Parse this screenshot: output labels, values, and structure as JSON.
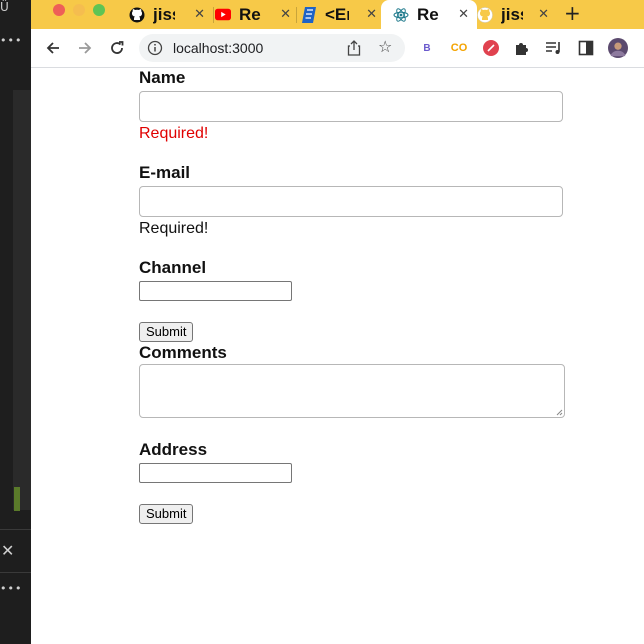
{
  "browser": {
    "tabs": [
      {
        "label": "jissl",
        "icon": "github-icon"
      },
      {
        "label": "Rea",
        "icon": "youtube-icon"
      },
      {
        "label": "<Err",
        "icon": "docs-icon"
      },
      {
        "label": "Rea",
        "icon": "react-icon",
        "active": true
      },
      {
        "label": "jissl",
        "icon": "github-icon"
      }
    ],
    "close_glyph": "✕",
    "new_tab_glyph": "+",
    "url": "localhost:3000",
    "extensions": [
      {
        "text": "B",
        "color": "#6a5acd"
      },
      {
        "text": "CO",
        "color": "#f4a300"
      }
    ],
    "titlebar_color": "#f7c948"
  },
  "form": {
    "name_label": "Name",
    "name_error": "Required!",
    "email_label": "E-mail",
    "email_error": "Required!",
    "channel_label": "Channel",
    "submit_1": "Submit",
    "comments_label": "Comments",
    "address_label": "Address",
    "submit_2": "Submit",
    "error_color": "#e00000",
    "plain_error_color": "#111111"
  }
}
